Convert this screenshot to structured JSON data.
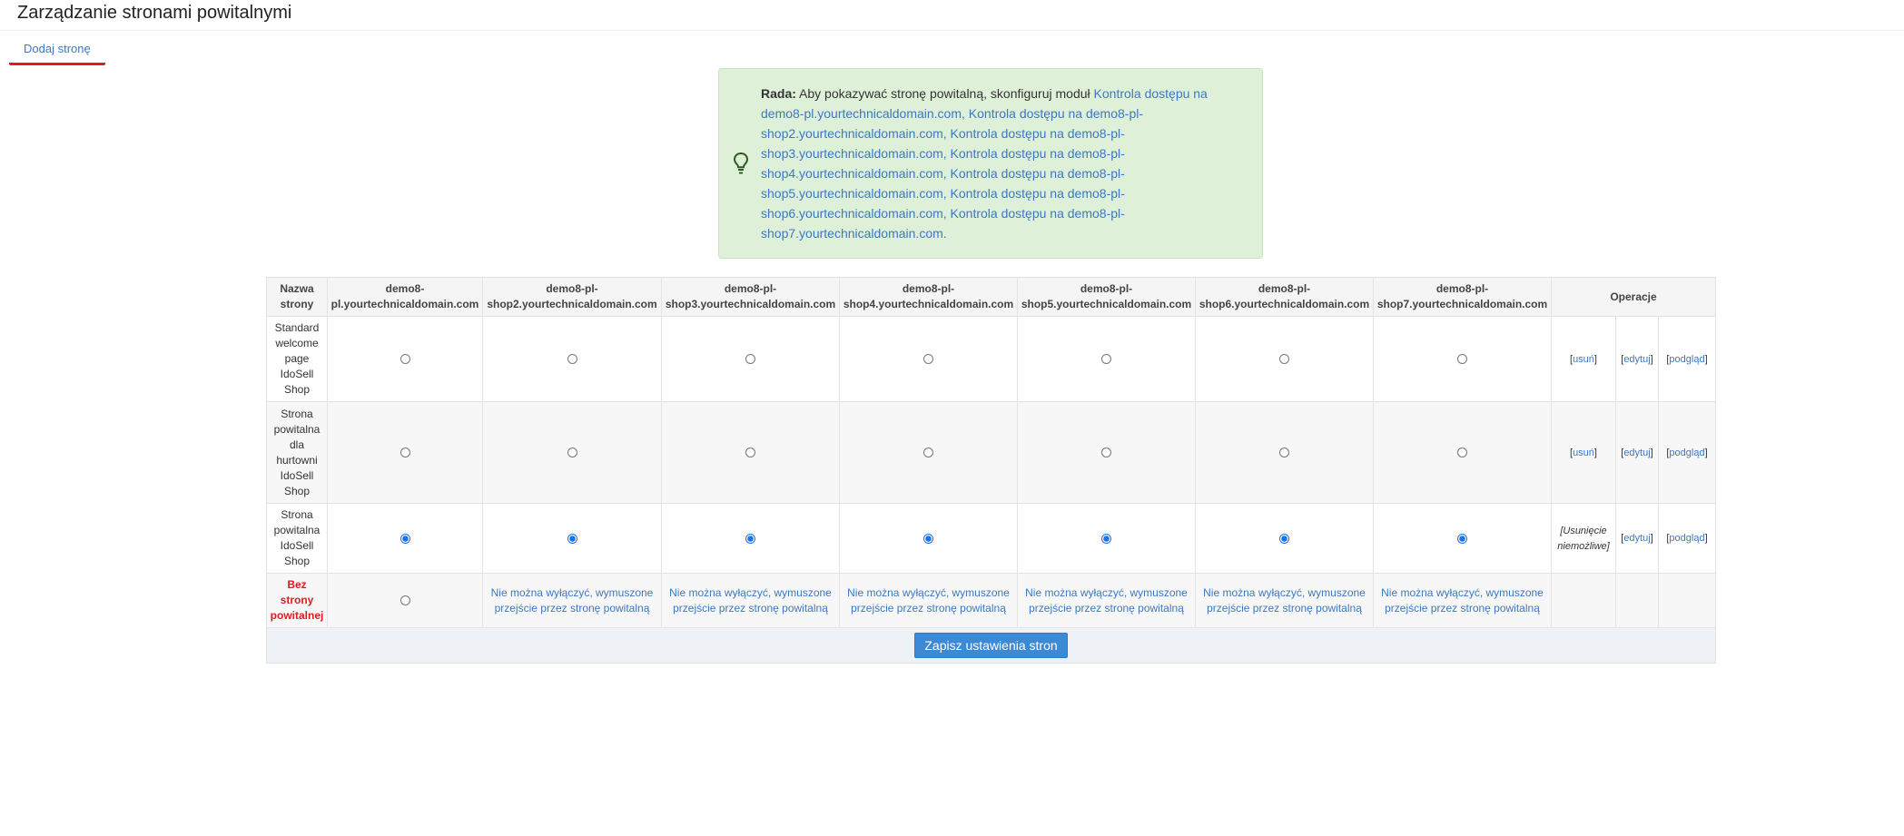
{
  "page": {
    "title": "Zarządzanie stronami powitalnymi"
  },
  "tabs": {
    "add_page": "Dodaj stronę"
  },
  "hint": {
    "label": "Rada:",
    "intro": " Aby pokazywać stronę powitalną, skonfiguruj moduł ",
    "lines": [
      "Kontrola dostępu na",
      "demo8-pl.yourtechnicaldomain.com, Kontrola dostępu na demo8-pl-",
      "shop2.yourtechnicaldomain.com, Kontrola dostępu na demo8-pl-",
      "shop3.yourtechnicaldomain.com, Kontrola dostępu na demo8-pl-",
      "shop4.yourtechnicaldomain.com, Kontrola dostępu na demo8-pl-",
      "shop5.yourtechnicaldomain.com, Kontrola dostępu na demo8-pl-",
      "shop6.yourtechnicaldomain.com, Kontrola dostępu na demo8-pl-",
      "shop7.yourtechnicaldomain.com."
    ]
  },
  "table": {
    "headers": {
      "name_line1": "Nazwa",
      "name_line2": "strony",
      "cols": [
        {
          "l1": "demo8-",
          "l2": "pl.yourtechnicaldomain.com"
        },
        {
          "l1": "demo8-pl-",
          "l2": "shop2.yourtechnicaldomain.com"
        },
        {
          "l1": "demo8-pl-",
          "l2": "shop3.yourtechnicaldomain.com"
        },
        {
          "l1": "demo8-pl-",
          "l2": "shop4.yourtechnicaldomain.com"
        },
        {
          "l1": "demo8-pl-",
          "l2": "shop5.yourtechnicaldomain.com"
        },
        {
          "l1": "demo8-pl-",
          "l2": "shop6.yourtechnicaldomain.com"
        },
        {
          "l1": "demo8-pl-",
          "l2": "shop7.yourtechnicaldomain.com"
        }
      ],
      "operations": "Operacje"
    },
    "rows": [
      {
        "name_lines": [
          "Standard",
          "welcome",
          "page",
          "IdoSell",
          "Shop"
        ],
        "selected": [
          false,
          false,
          false,
          false,
          false,
          false,
          false
        ],
        "op_delete": "usuń",
        "op_edit": "edytuj",
        "op_preview": "podgląd"
      },
      {
        "name_lines": [
          "Strona",
          "powitalna",
          "dla",
          "hurtowni",
          "IdoSell",
          "Shop"
        ],
        "selected": [
          false,
          false,
          false,
          false,
          false,
          false,
          false
        ],
        "op_delete": "usuń",
        "op_edit": "edytuj",
        "op_preview": "podgląd"
      },
      {
        "name_lines": [
          "Strona",
          "powitalna",
          "IdoSell",
          "Shop"
        ],
        "selected": [
          true,
          true,
          true,
          true,
          true,
          true,
          true
        ],
        "op_cannot_delete_l1": "[Usunięcie",
        "op_cannot_delete_l2": "niemożliwe]",
        "op_edit": "edytuj",
        "op_preview": "podgląd"
      }
    ],
    "no_page": {
      "name_lines": [
        "Bez",
        "strony",
        "powitalnej"
      ],
      "forced_l1": "Nie można wyłączyć, wymuszone",
      "forced_l2": "przejście przez stronę powitalną"
    },
    "save_button": "Zapisz ustawienia stron"
  },
  "colors": {
    "accent": "#3c78c3",
    "hint_bg": "#dff0d8",
    "danger": "#e01b22",
    "button": "#3c8ad6"
  }
}
